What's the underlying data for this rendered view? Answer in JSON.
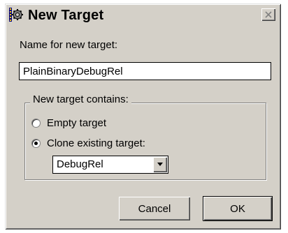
{
  "dialog": {
    "title": "New Target",
    "close_icon": "close-icon",
    "app_icon": "gear-chip-icon"
  },
  "name_field": {
    "label": "Name for new target:",
    "value": "PlainBinaryDebugRel"
  },
  "target_group": {
    "legend": "New target contains:",
    "options": [
      {
        "label": "Empty target",
        "selected": false
      },
      {
        "label": "Clone existing target:",
        "selected": true
      }
    ],
    "clone_select": {
      "value": "DebugRel"
    }
  },
  "buttons": {
    "cancel_label": "Cancel",
    "ok_label": "OK"
  }
}
